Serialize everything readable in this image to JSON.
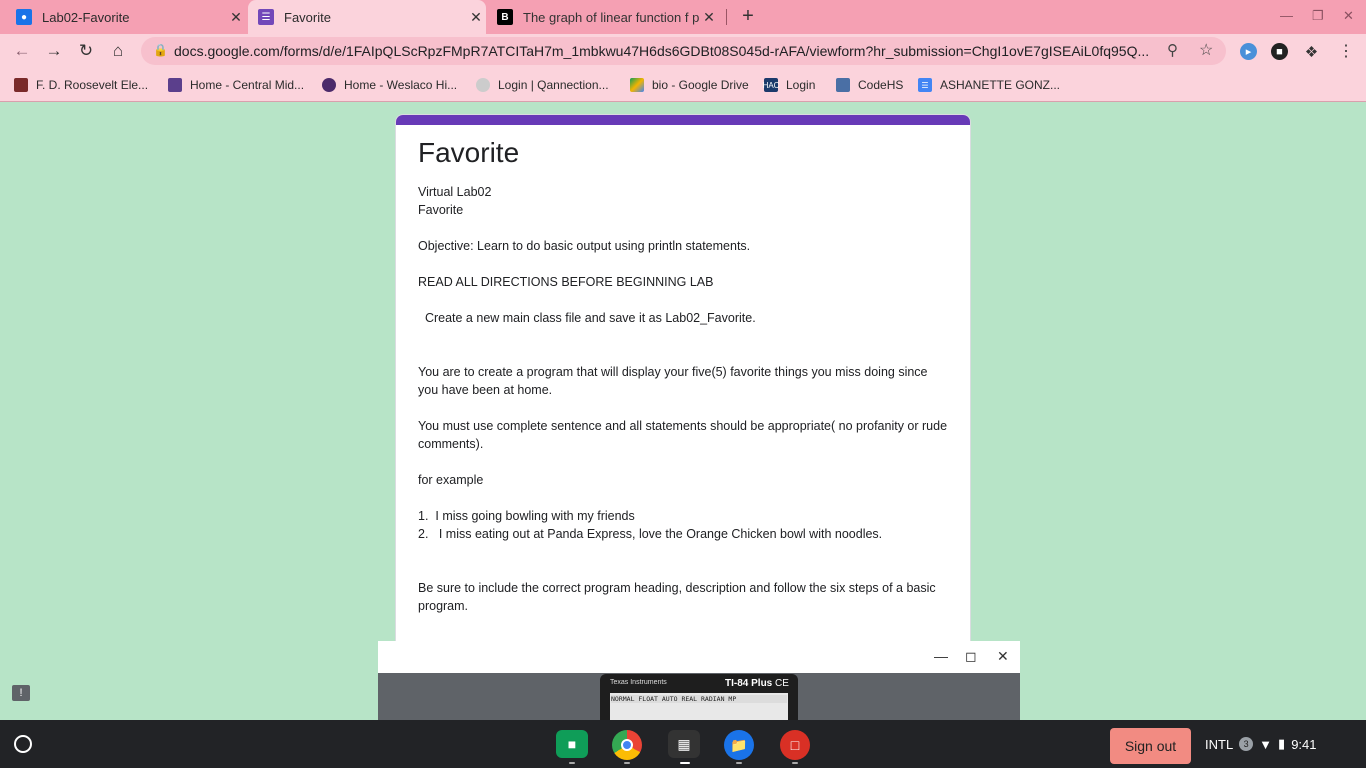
{
  "tabs": [
    {
      "title": "Lab02-Favorite",
      "favicon": "classroom-icon",
      "active": false
    },
    {
      "title": "Favorite",
      "favicon": "forms-icon",
      "active": true
    },
    {
      "title": "The graph of linear function f pa",
      "favicon": "brainly-icon",
      "active": false
    }
  ],
  "omnibox": {
    "url": "docs.google.com/forms/d/e/1FAIpQLScRpzFMpR7ATCITaH7m_1mbkwu47H6ds6GDBt08S045d-rAFA/viewform?hr_submission=ChgI1ovE7gISEAiL0fq95Q..."
  },
  "bookmarks": [
    {
      "label": "F. D. Roosevelt Ele...",
      "icon": "school-icon"
    },
    {
      "label": "Home - Central Mid...",
      "icon": "school-icon"
    },
    {
      "label": "Home - Weslaco Hi...",
      "icon": "crest-icon"
    },
    {
      "label": "Login | Qannection...",
      "icon": "qannection-icon"
    },
    {
      "label": "bio - Google Drive",
      "icon": "drive-icon"
    },
    {
      "label": "Login",
      "icon": "hac-icon"
    },
    {
      "label": "CodeHS",
      "icon": "codehs-icon"
    },
    {
      "label": "ASHANETTE GONZ...",
      "icon": "docs-icon"
    }
  ],
  "form": {
    "title": "Favorite",
    "lines": [
      "Virtual Lab02",
      "Favorite",
      "",
      "Objective: Learn to do basic output using println statements.",
      "",
      "READ ALL DIRECTIONS BEFORE BEGINNING LAB",
      "",
      "  Create a new main class file and save it as Lab02_Favorite.",
      "",
      "",
      "You are to create a  program that will display your five(5) favorite things you miss doing since you have been at home.",
      "",
      "You must use complete sentence and all statements should be appropriate( no profanity or rude comments).",
      "",
      "for example",
      "",
      "1.  I miss going bowling with my friends",
      "2.   I miss eating out at Panda Express, love the Orange Chicken bowl with noodles.",
      "",
      "",
      "Be sure to include the correct program heading, description and follow the six steps of a basic program."
    ]
  },
  "calculator": {
    "brand": "Texas Instruments",
    "model_bold": "TI-84 Plus",
    "model_suffix": "CE",
    "status_line": "NORMAL FLOAT AUTO REAL RADIAN MP"
  },
  "shelf": {
    "apps": [
      "classroom-icon",
      "chrome-icon",
      "calculator-icon",
      "files-icon",
      "gallery-icon"
    ],
    "signout": "Sign out",
    "ime": "INTL",
    "notifications": "3",
    "clock": "9:41"
  }
}
